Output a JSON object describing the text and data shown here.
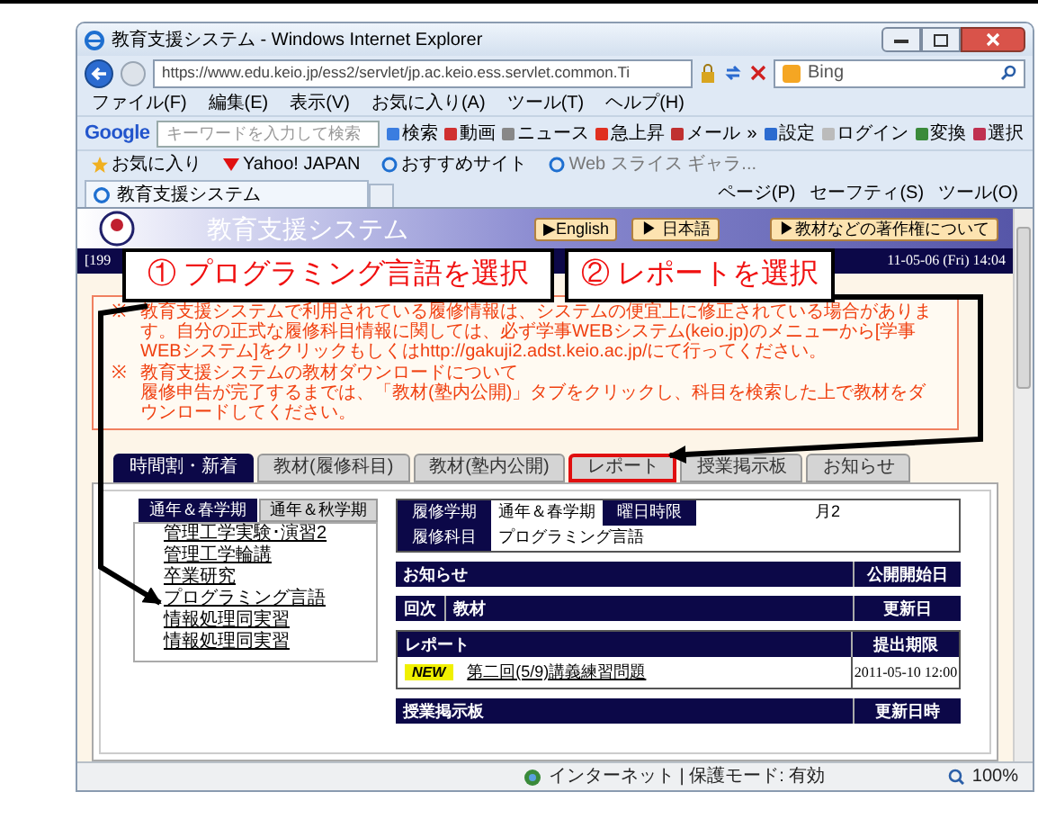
{
  "window": {
    "title": "教育支援システム - Windows Internet Explorer"
  },
  "address_bar": {
    "url": "https://www.edu.keio.jp/ess2/servlet/jp.ac.keio.ess.servlet.common.Ti",
    "search_placeholder": "Bing"
  },
  "menu_bar": [
    "ファイル(F)",
    "編集(E)",
    "表示(V)",
    "お気に入り(A)",
    "ツール(T)",
    "ヘルプ(H)"
  ],
  "google_toolbar": {
    "logo": "Google",
    "placeholder": "キーワードを入力して検索",
    "buttons": [
      "検索",
      "動画",
      "ニュース",
      "急上昇",
      "メール",
      "»",
      "設定",
      "ログイン",
      "変換",
      "選択"
    ]
  },
  "favorites_bar": [
    "お気に入り",
    "Yahoo! JAPAN",
    "おすすめサイト",
    "Web スライス ギャラ..."
  ],
  "browser_tab": {
    "title": "教育支援システム"
  },
  "command_bar": [
    "ページ(P)",
    "セーフティ(S)",
    "ツール(O)"
  ],
  "page": {
    "site_title": "教育支援システム",
    "header_buttons": [
      "▶English",
      "▶ 日本語",
      "▶教材などの著作権について"
    ],
    "info_bar": {
      "left": "[199",
      "right": "11-05-06 (Fri) 14:04"
    },
    "notices": [
      {
        "mark": "※",
        "lines": [
          "教育支援システムで利用されている履修情報は、システムの便宜上に修正されている場合があります。自分の正式な履修科目情報に関しては、必ず学事WEBシステム(keio.jp)のメニューから[学事WEBシステム]をクリックもしくはhttp://gakuji2.adst.keio.ac.jp/にて行ってください。"
        ]
      },
      {
        "mark": "※",
        "lines": [
          "教育支援システムの教材ダウンロードについて",
          "履修申告が完了するまでは、「教材(塾内公開)」タブをクリックし、科目を検索した上で教材をダウンロードしてください。"
        ]
      }
    ],
    "tabs": [
      {
        "label": "時間割・新着",
        "selected": true,
        "highlighted": false
      },
      {
        "label": "教材(履修科目)",
        "selected": false,
        "highlighted": false
      },
      {
        "label": "教材(塾内公開)",
        "selected": false,
        "highlighted": false
      },
      {
        "label": "レポート",
        "selected": false,
        "highlighted": true
      },
      {
        "label": "授業掲示板",
        "selected": false,
        "highlighted": false
      },
      {
        "label": "お知らせ",
        "selected": false,
        "highlighted": false
      }
    ],
    "term_tabs": [
      {
        "label": "通年＆春学期",
        "selected": true
      },
      {
        "label": "通年＆秋学期",
        "selected": false
      }
    ],
    "courses": [
      "管理工学実験･演習2",
      "管理工学輪講",
      "卒業研究",
      "プログラミング言語",
      "情報処理同実習",
      "情報処理同実習"
    ],
    "course_info": [
      {
        "label": "履修学期",
        "value": "通年＆春学期",
        "label2": "曜日時限",
        "value2": "月2"
      },
      {
        "label": "履修科目",
        "value": "プログラミング言語"
      }
    ],
    "sections": [
      {
        "columns": [
          "お知らせ",
          "公開開始日"
        ]
      },
      {
        "columns": [
          "回次",
          "教材",
          "更新日"
        ]
      },
      {
        "columns": [
          "レポート",
          "提出期限"
        ],
        "rows": [
          {
            "badge": "NEW",
            "title": "第二回(5/9)講義練習問題",
            "date": "2011-05-10 12:00"
          }
        ]
      },
      {
        "columns": [
          "授業掲示板",
          "更新日時"
        ]
      }
    ]
  },
  "annotations": [
    {
      "text": "① プログラミング言語を選択"
    },
    {
      "text": "② レポートを選択"
    }
  ],
  "status_bar": {
    "zone": "インターネット | 保護モード: 有効",
    "zoom": "100%"
  }
}
